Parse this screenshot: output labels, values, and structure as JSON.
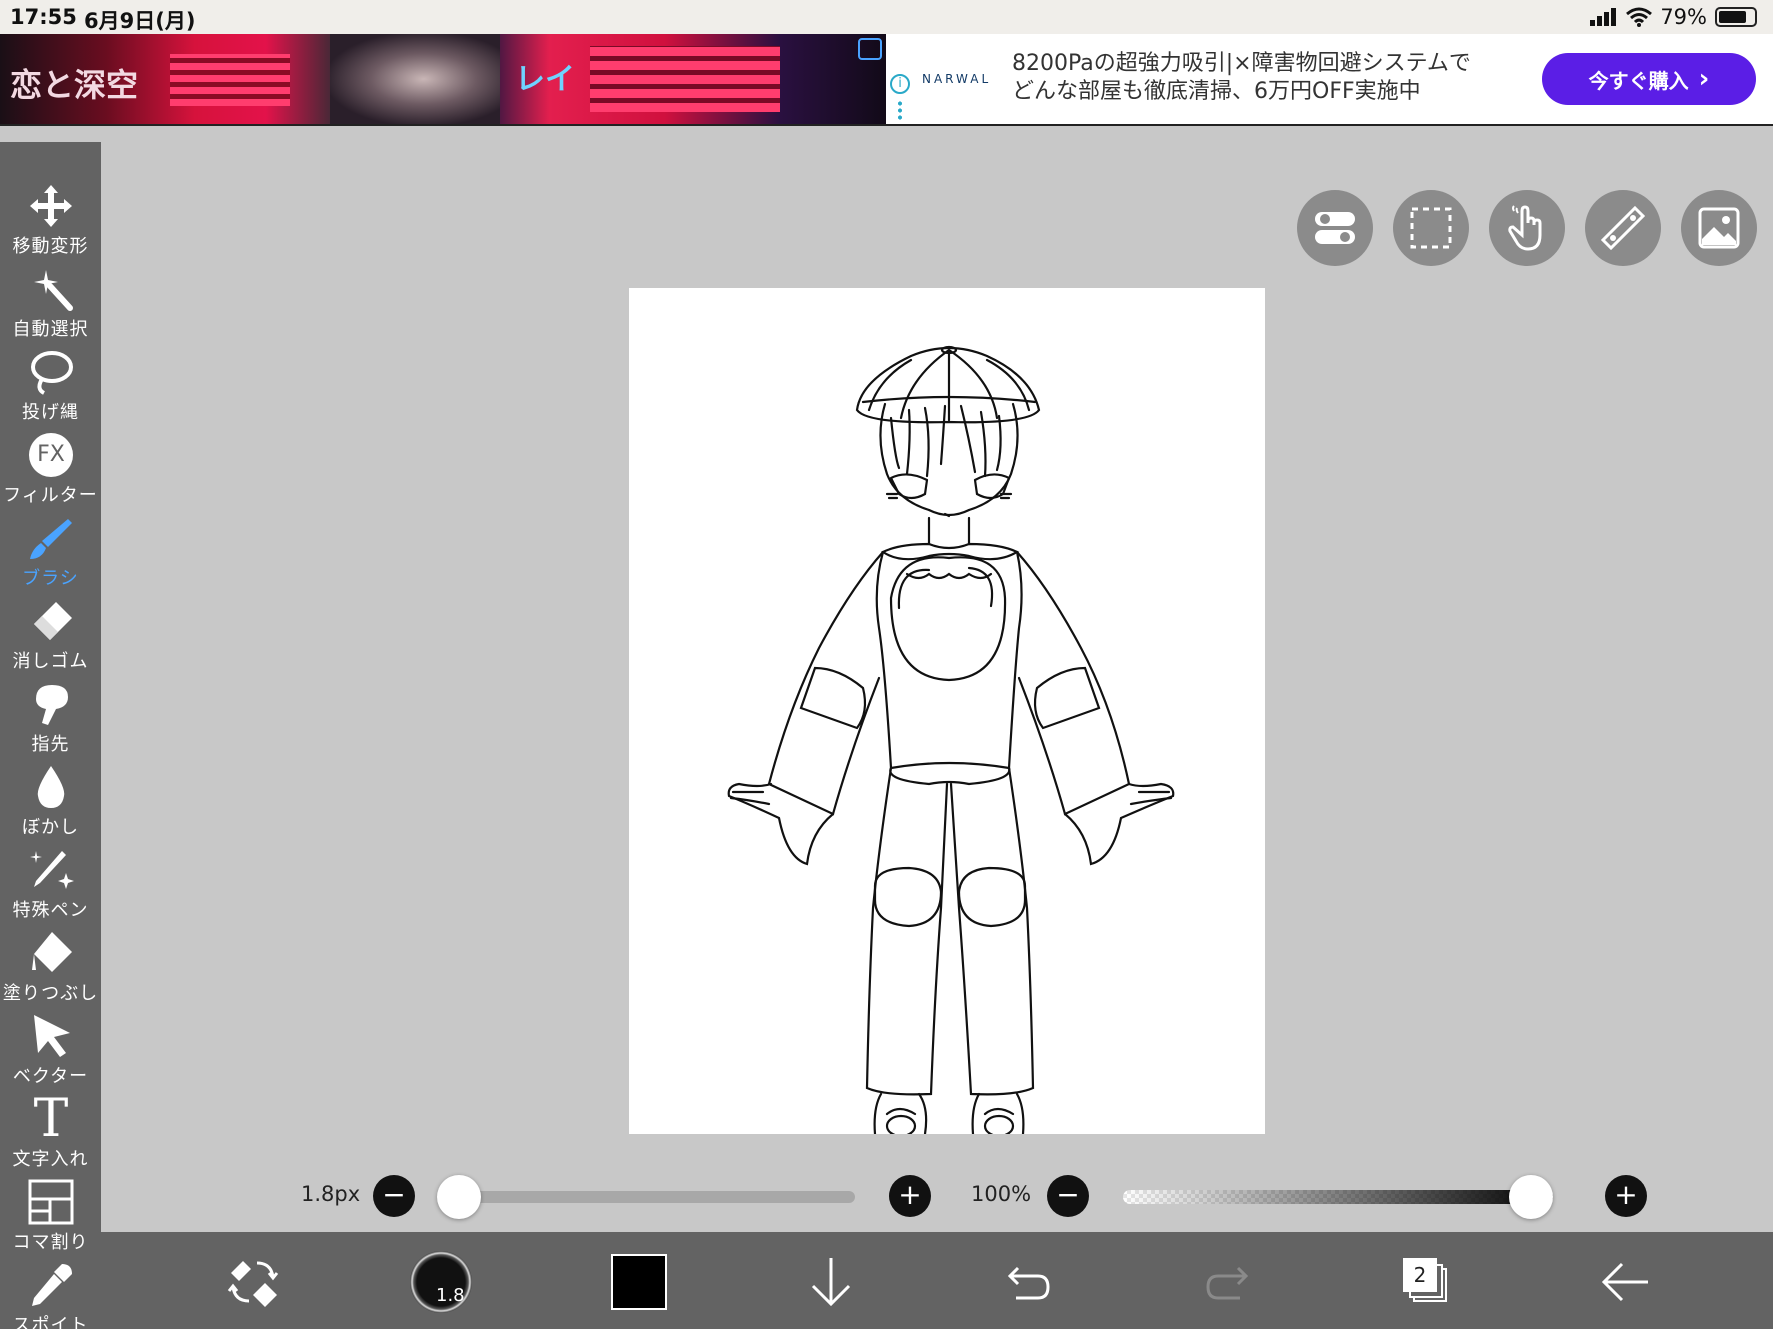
{
  "status_bar": {
    "time": "17:55",
    "date": "6月9日(月)",
    "battery": "79%",
    "battery_level": 0.79
  },
  "ad": {
    "brand": "NARWAL",
    "text_line1": "8200Paの超強力吸引|×障害物回避システムで",
    "text_line2": "どんな部屋も徹底清掃、6万円OFF実施中",
    "cta": "今すぐ購入",
    "cta_chevron": "›",
    "art_text_1": "恋と深空",
    "art_text_2": "レイ"
  },
  "sidebar": {
    "tools": [
      {
        "id": "move",
        "label": "移動変形",
        "icon": "move-icon"
      },
      {
        "id": "magic",
        "label": "自動選択",
        "icon": "magic-wand-icon"
      },
      {
        "id": "lasso",
        "label": "投げ縄",
        "icon": "lasso-icon"
      },
      {
        "id": "filter",
        "label": "フィルター",
        "icon": "fx-icon",
        "icon_text": "FX"
      },
      {
        "id": "brush",
        "label": "ブラシ",
        "icon": "brush-icon",
        "active": true
      },
      {
        "id": "eraser",
        "label": "消しゴム",
        "icon": "eraser-icon"
      },
      {
        "id": "finger",
        "label": "指先",
        "icon": "finger-icon"
      },
      {
        "id": "blur",
        "label": "ぼかし",
        "icon": "blur-drop-icon"
      },
      {
        "id": "special",
        "label": "特殊ペン",
        "icon": "sparkle-pen-icon"
      },
      {
        "id": "fill",
        "label": "塗りつぶし",
        "icon": "bucket-icon"
      },
      {
        "id": "vector",
        "label": "ベクター",
        "icon": "cursor-arrow-icon"
      },
      {
        "id": "text",
        "label": "文字入れ",
        "icon": "text-t-icon",
        "icon_text": "T"
      },
      {
        "id": "frame",
        "label": "コマ割り",
        "icon": "panel-layout-icon"
      },
      {
        "id": "eyedropper",
        "label": "スポイト",
        "icon": "eyedropper-icon"
      }
    ]
  },
  "canvas_toolbar": {
    "buttons": [
      {
        "id": "toggle",
        "icon": "toggle-icon"
      },
      {
        "id": "select",
        "icon": "selection-rect-icon"
      },
      {
        "id": "gesture",
        "icon": "hand-touch-icon"
      },
      {
        "id": "ruler",
        "icon": "ruler-icon"
      },
      {
        "id": "material",
        "icon": "image-icon"
      }
    ]
  },
  "sliders": {
    "brush_size_label": "1.8px",
    "brush_size_fraction": 0.0,
    "opacity_label": "100%",
    "opacity_fraction": 1.0,
    "minus": "−",
    "plus": "+"
  },
  "bottom_bar": {
    "brush_size_badge": "1.8",
    "current_color": "#000000",
    "layer_count": "2"
  },
  "colors": {
    "accent": "#4aa3ff",
    "toolbar_bg": "#636363",
    "workspace_bg": "#c8c8c8",
    "cta": "#5b1ee6"
  }
}
